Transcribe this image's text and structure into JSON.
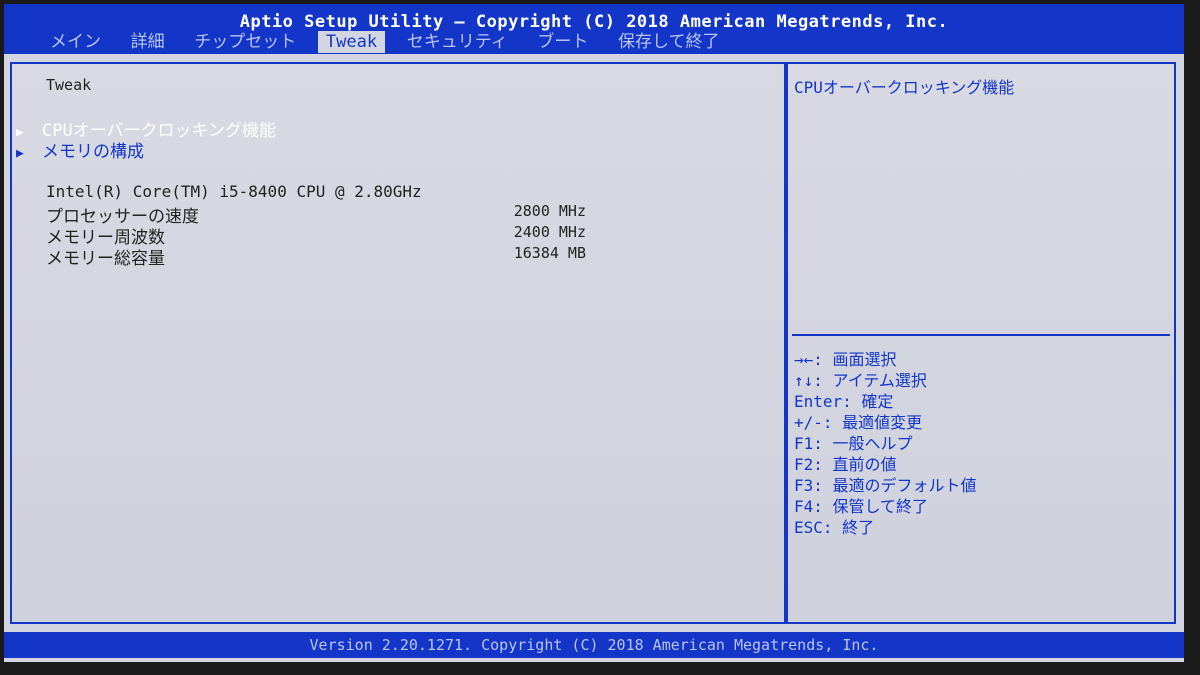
{
  "header": {
    "title": "Aptio Setup Utility – Copyright (C) 2018 American Megatrends, Inc."
  },
  "tabs": [
    {
      "label": "メイン"
    },
    {
      "label": "詳細"
    },
    {
      "label": "チップセット"
    },
    {
      "label": "Tweak"
    },
    {
      "label": "セキュリティ"
    },
    {
      "label": "ブート"
    },
    {
      "label": "保存して終了"
    }
  ],
  "active_tab": "Tweak",
  "main": {
    "heading": "Tweak",
    "menu": [
      {
        "arrow": "▶",
        "label": "CPUオーバークロッキング機能"
      },
      {
        "arrow": "▶",
        "label": "メモリの構成"
      }
    ],
    "cpu_name": "Intel(R) Core(TM) i5-8400 CPU @ 2.80GHz",
    "info": [
      {
        "label": "プロセッサーの速度",
        "value": "2800 MHz"
      },
      {
        "label": "メモリー周波数",
        "value": "2400 MHz"
      },
      {
        "label": "メモリー総容量",
        "value": "16384 MB"
      }
    ]
  },
  "help": {
    "description": "CPUオーバークロッキング機能",
    "keys": [
      "→←: 画面選択",
      "↑↓: アイテム選択",
      "Enter: 確定",
      "+/-: 最適値変更",
      "F1: 一般ヘルプ",
      "F2: 直前の値",
      "F3: 最適のデフォルト値",
      "F4: 保管して終了",
      "ESC: 終了"
    ]
  },
  "footer": {
    "text": "Version 2.20.1271. Copyright (C) 2018 American Megatrends, Inc."
  },
  "colors": {
    "accent": "#1336c9",
    "background": "#d3d5e0",
    "selected_text": "#ffffff"
  }
}
